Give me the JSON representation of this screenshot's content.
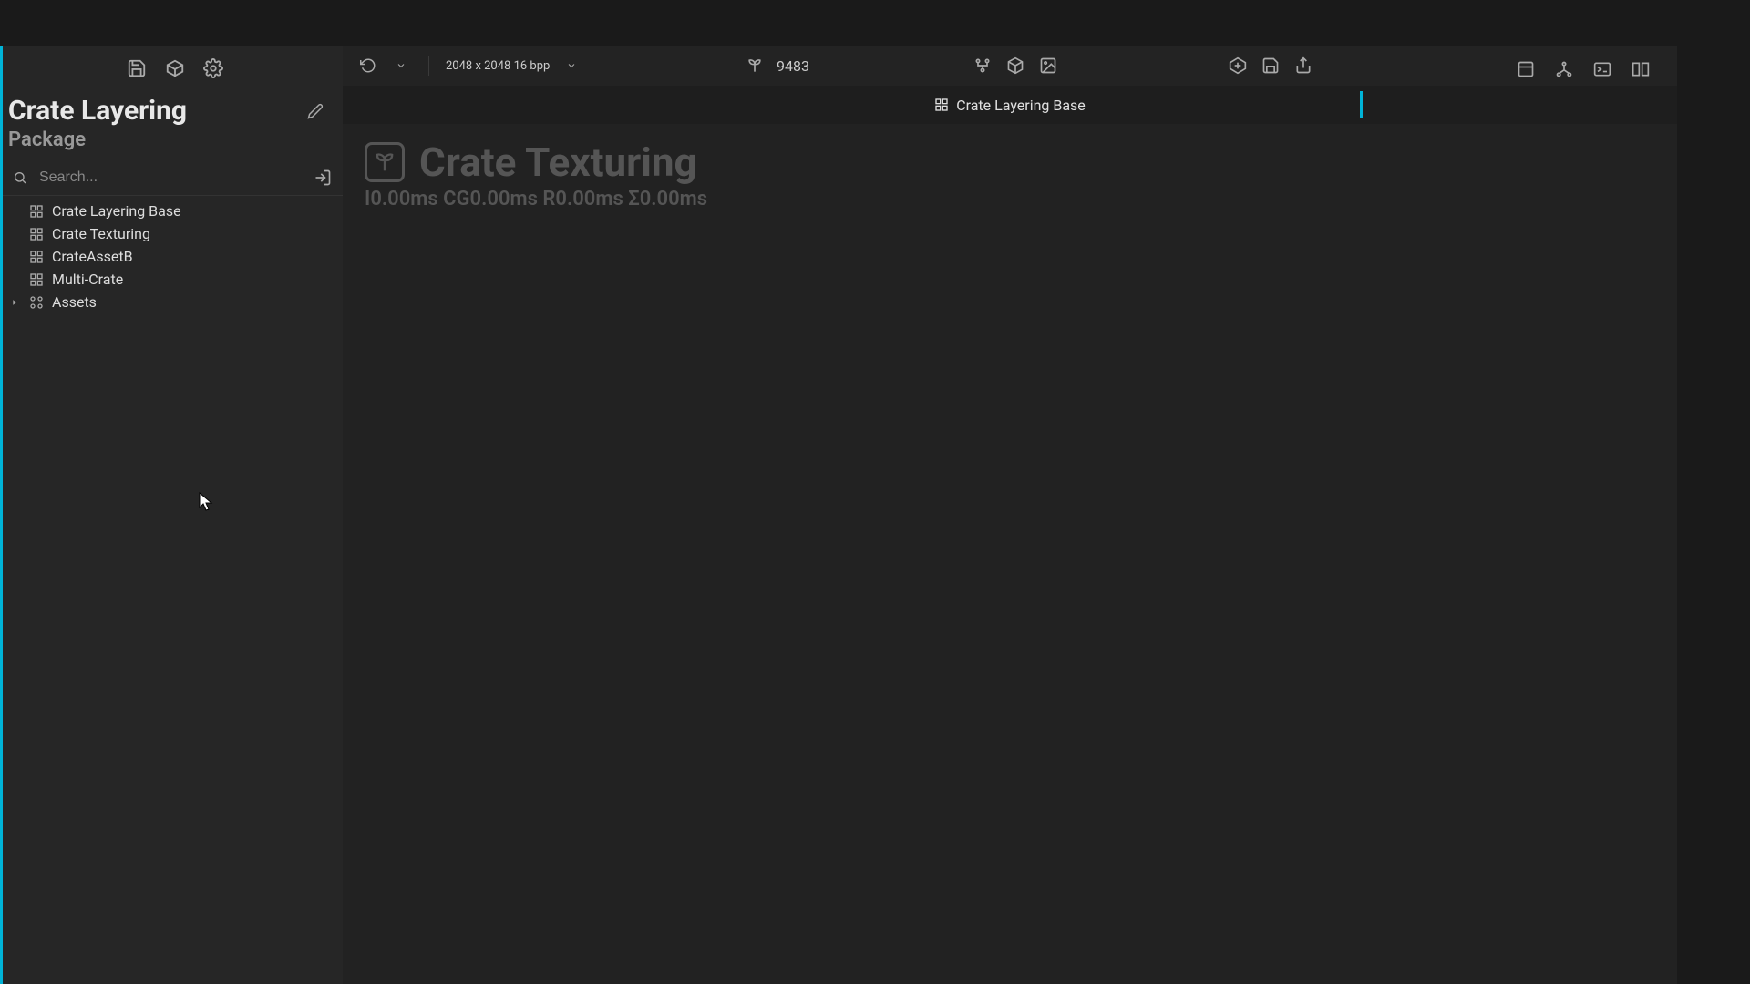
{
  "sidebar": {
    "title": "Crate Layering",
    "subtitle": "Package",
    "search_placeholder": "Search...",
    "items": [
      {
        "label": "Crate Layering Base",
        "type": "graph"
      },
      {
        "label": "Crate Texturing",
        "type": "graph"
      },
      {
        "label": "CrateAssetB",
        "type": "graph"
      },
      {
        "label": "Multi-Crate",
        "type": "graph"
      },
      {
        "label": "Assets",
        "type": "folder"
      }
    ]
  },
  "toolbar": {
    "resolution": "2048 x 2048 16 bpp",
    "stat_number": "9483"
  },
  "tab": {
    "label": "Crate Layering Base"
  },
  "graph": {
    "title": "Crate Texturing",
    "stats": "I0.00ms CG0.00ms R0.00ms Σ0.00ms"
  }
}
